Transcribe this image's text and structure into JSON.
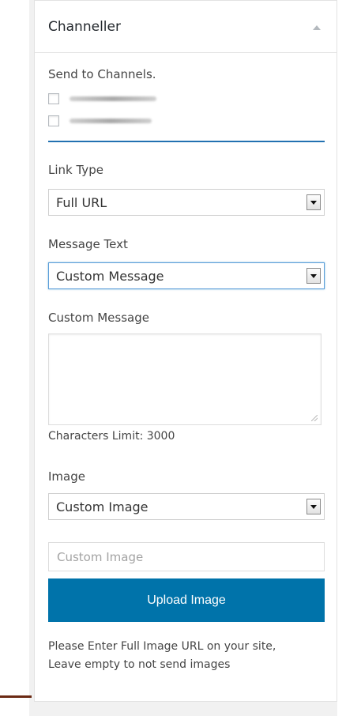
{
  "widget": {
    "title": "Channeller"
  },
  "channels": {
    "label": "Send to Channels."
  },
  "link_type": {
    "label": "Link Type",
    "selected": "Full URL"
  },
  "message_text": {
    "label": "Message Text",
    "selected": "Custom Message"
  },
  "custom_message": {
    "label": "Custom Message",
    "value": "",
    "limit_text": "Characters Limit: 3000"
  },
  "image": {
    "label": "Image",
    "selected": "Custom Image",
    "url_placeholder": "Custom Image",
    "upload_label": "Upload Image",
    "help_line1": "Please Enter Full Image URL on your site,",
    "help_line2": "Leave empty to not send images"
  },
  "colors": {
    "accent": "#0073aa",
    "divider": "#2271b1"
  }
}
